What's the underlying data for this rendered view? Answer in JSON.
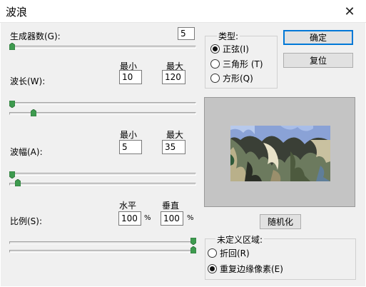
{
  "window": {
    "title": "波浪",
    "close_glyph": "✕"
  },
  "generators": {
    "label": "生成器数(G):",
    "value": "5",
    "slider_fraction": 0.0
  },
  "wavelength": {
    "label": "波长(W):",
    "min_header": "最小",
    "max_header": "最大",
    "min_value": "10",
    "max_value": "120",
    "min_slider_fraction": 0.0,
    "max_slider_fraction": 0.12
  },
  "amplitude": {
    "label": "波幅(A):",
    "min_header": "最小",
    "max_header": "最大",
    "min_value": "5",
    "max_value": "35",
    "min_slider_fraction": 0.0,
    "max_slider_fraction": 0.03
  },
  "scale": {
    "label": "比例(S):",
    "horizontal_header": "水平",
    "vertical_header": "垂直",
    "horizontal_value": "100",
    "vertical_value": "100",
    "unit": "%",
    "horizontal_slider_fraction": 1.0,
    "vertical_slider_fraction": 1.0
  },
  "type_group": {
    "title": "类型:",
    "options": [
      {
        "label": "正弦(I)",
        "selected": true
      },
      {
        "label": "三角形 (T)",
        "selected": false
      },
      {
        "label": "方形(Q)",
        "selected": false
      }
    ]
  },
  "buttons": {
    "ok": "确定",
    "reset": "复位",
    "randomize": "随机化"
  },
  "undefined_areas": {
    "title": "未定义区域:",
    "options": [
      {
        "label": "折回(R)",
        "selected": false
      },
      {
        "label": "重复边缘像素(E)",
        "selected": true
      }
    ]
  },
  "colors": {
    "accent": "#0078d7",
    "slider_thumb": "#3e9b4f",
    "dialog_bg": "#f0f0f0",
    "preview_bg": "#c4c4c4"
  }
}
